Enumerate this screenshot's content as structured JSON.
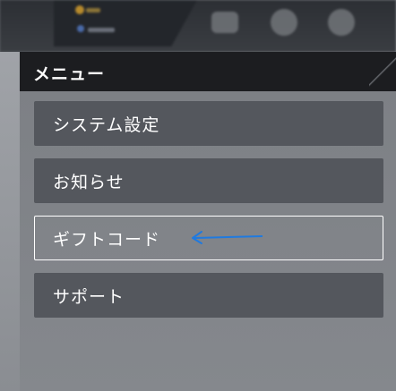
{
  "menu": {
    "title": "メニュー",
    "items": [
      {
        "label": "システム設定"
      },
      {
        "label": "お知らせ"
      },
      {
        "label": "ギフトコード",
        "selected": true
      },
      {
        "label": "サポート"
      }
    ]
  },
  "colors": {
    "header_bg": "#1c1d20",
    "button_bg": "#54575d",
    "panel_bg": "#7c7f84",
    "selected_border": "#ffffff",
    "annotation_arrow": "#1f7ae0"
  },
  "hud": {
    "icons": [
      "mail-icon",
      "wrench-icon",
      "gear-icon"
    ]
  }
}
